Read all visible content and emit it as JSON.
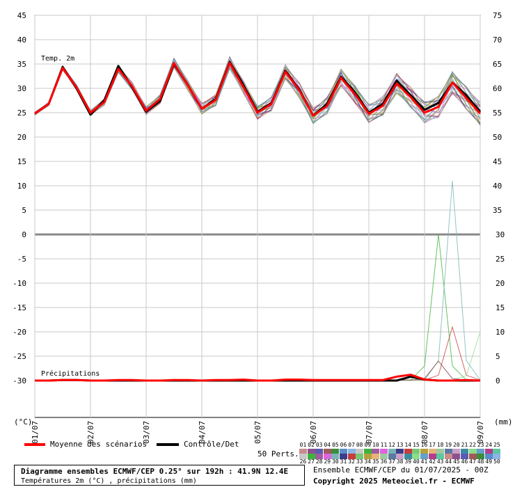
{
  "chart_data": {
    "type": "line",
    "temp_label": "Temp. 2m",
    "precip_label": "Précipitations",
    "left_unit": "(°C)",
    "right_unit": "(mm)",
    "left_ticks": [
      45,
      40,
      35,
      30,
      25,
      20,
      15,
      10,
      5,
      0,
      -5,
      -10,
      -15,
      -20,
      -25,
      -30
    ],
    "right_ticks_temp": [
      75,
      70,
      65,
      60,
      55,
      50,
      45,
      40,
      35
    ],
    "right_ticks_precip": [
      30,
      25,
      20,
      15,
      10,
      5,
      0
    ],
    "x_labels": [
      "01/07",
      "02/07",
      "03/07",
      "04/07",
      "05/07",
      "06/07",
      "07/07",
      "08/07",
      "09/07"
    ],
    "temp_x_hours": [
      0,
      6,
      12,
      18,
      24,
      30,
      36,
      42,
      48,
      54,
      60,
      66,
      72,
      78,
      84,
      90,
      96,
      102,
      108,
      114,
      120,
      126,
      132,
      138,
      144,
      150,
      156,
      162,
      168,
      174,
      180,
      186,
      192
    ],
    "temp_mean": [
      24.8,
      26.8,
      34.2,
      30.2,
      25.0,
      27.2,
      34.0,
      30.4,
      25.4,
      27.8,
      35.2,
      30.6,
      25.8,
      27.6,
      35.2,
      30.2,
      25.0,
      26.8,
      33.4,
      29.6,
      24.4,
      26.4,
      32.2,
      28.8,
      24.8,
      26.4,
      31.0,
      28.2,
      25.0,
      26.2,
      31.2,
      28.0,
      24.8
    ],
    "temp_control": [
      24.8,
      26.8,
      34.4,
      30.0,
      24.6,
      27.6,
      34.6,
      30.2,
      25.2,
      27.4,
      35.0,
      30.6,
      25.8,
      27.8,
      35.4,
      30.6,
      25.2,
      27.0,
      33.6,
      29.8,
      24.4,
      26.8,
      32.4,
      29.2,
      25.0,
      26.8,
      31.6,
      28.6,
      25.6,
      27.0,
      31.2,
      28.6,
      25.2
    ],
    "precip_x_hours": [
      0,
      6,
      12,
      18,
      24,
      30,
      36,
      42,
      48,
      54,
      60,
      66,
      72,
      78,
      84,
      90,
      96,
      102,
      108,
      114,
      120,
      126,
      132,
      138,
      144,
      150,
      156,
      162,
      168,
      174,
      180,
      186,
      192
    ],
    "precip_mean": [
      0,
      0,
      0.1,
      0.1,
      0,
      0,
      0.1,
      0.1,
      0,
      0,
      0.1,
      0.1,
      0,
      0.1,
      0.1,
      0.2,
      0,
      0,
      0.2,
      0.2,
      0.1,
      0.1,
      0.1,
      0.1,
      0.1,
      0.1,
      0.8,
      1.2,
      0.2,
      0,
      0,
      0.1,
      0
    ],
    "precip_control": [
      0,
      0,
      0.1,
      0.1,
      0,
      0,
      0,
      0,
      0,
      0,
      0,
      0,
      0,
      0,
      0,
      0,
      0,
      0,
      0,
      0,
      0,
      0,
      0,
      0,
      0,
      0,
      0,
      0.8,
      0.2,
      0,
      0,
      0,
      0
    ],
    "legend": {
      "mean_label": "Moyenne des scénarios",
      "mean_color": "#ff0000",
      "control_label": "Contrôle/Det",
      "control_color": "#000000",
      "perts_label": "50 Perts.",
      "pert_numbers_row1": [
        "01",
        "02",
        "03",
        "04",
        "05",
        "06",
        "07",
        "08",
        "09",
        "10",
        "11",
        "12",
        "13",
        "14",
        "15",
        "16",
        "17",
        "18",
        "19",
        "20",
        "21",
        "22",
        "23",
        "24",
        "25"
      ],
      "pert_numbers_row2": [
        "26",
        "27",
        "28",
        "29",
        "30",
        "31",
        "32",
        "33",
        "34",
        "35",
        "36",
        "37",
        "38",
        "39",
        "40",
        "41",
        "42",
        "43",
        "44",
        "45",
        "46",
        "47",
        "48",
        "49",
        "50"
      ],
      "pert_colors": [
        "#c88c8c",
        "#8c508c",
        "#5a5ab4",
        "#a05a5a",
        "#3c8c3c",
        "#5a8cc8",
        "#8cb4e6",
        "#c8c8c8",
        "#3cb43c",
        "#a05aa0",
        "#dc64dc",
        "#78b4b4",
        "#3c3c8c",
        "#c83c3c",
        "#78c878",
        "#b4a03c",
        "#e6b478",
        "#a0c8a0",
        "#5a78a0",
        "#c8a0c8",
        "#3c8ca0",
        "#8cdc8c",
        "#64a0c8",
        "#b43c8c",
        "#5ac8a0"
      ]
    }
  },
  "footer": {
    "title": "Diagramme ensembles ECMWF/CEP 0.25° sur 192h : 41.9N 12.4E",
    "subtitle": "Températures 2m (°C) , précipitations (mm)",
    "ensemble_info": "Ensemble ECMWF/CEP du 01/07/2025 - 00Z",
    "copyright": "Copyright 2025 Meteociel.fr - ECMWF"
  }
}
